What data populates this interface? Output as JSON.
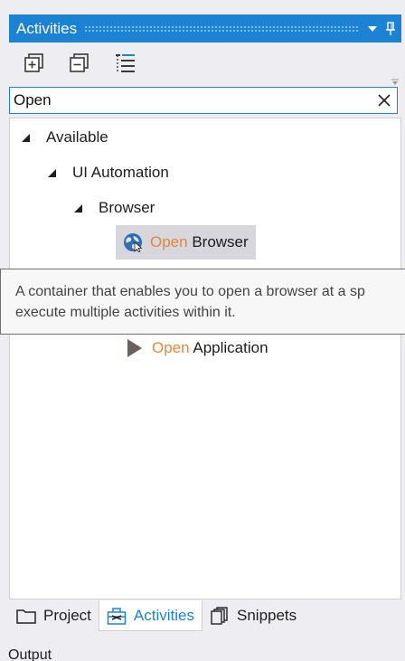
{
  "panel": {
    "title": "Activities"
  },
  "search": {
    "value": "Open",
    "placeholder": ""
  },
  "tree": {
    "available": "Available",
    "ui_automation": "UI Automation",
    "browser": "Browser",
    "open_browser": {
      "highlight": "Open",
      "rest": " Browser"
    },
    "open_application": {
      "highlight": "Open",
      "rest": " Application"
    }
  },
  "tooltip": {
    "line1": "A container that enables you to open a browser at a sp",
    "line2": "execute multiple activities within it."
  },
  "bottom_tabs": {
    "project": "Project",
    "activities": "Activities",
    "snippets": "Snippets"
  },
  "output_label": "Output",
  "colors": {
    "accent": "#1c83d4",
    "highlight": "#e1883a",
    "selected_row": "#d6d6dc"
  },
  "icons": {
    "dropdown": "chevron-down-icon",
    "pin": "pin-icon",
    "expand_all": "expand-all-icon",
    "collapse_all": "collapse-all-icon",
    "show_tree": "tree-view-icon",
    "clear": "close-icon",
    "open_browser": "globe-icon",
    "open_application": "play-icon",
    "project": "folder-icon",
    "activities": "toolbox-icon",
    "snippets": "snippets-icon"
  }
}
